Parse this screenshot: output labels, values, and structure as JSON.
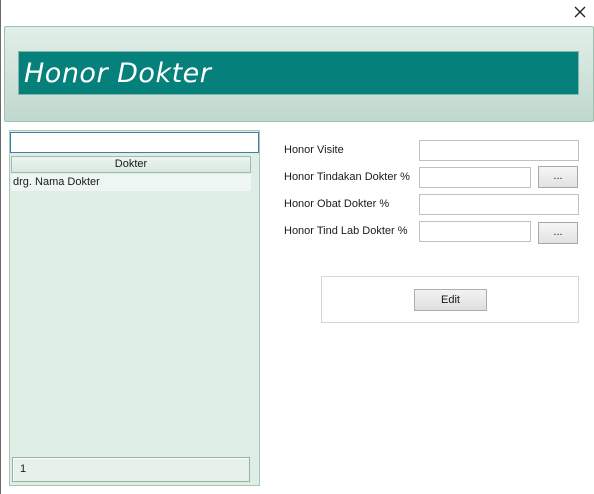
{
  "window": {
    "close_icon": "close-icon"
  },
  "header": {
    "title": "Honor Dokter"
  },
  "left_panel": {
    "search": {
      "value": "",
      "placeholder": ""
    },
    "grid": {
      "columns": [
        "Dokter"
      ],
      "rows": [
        [
          "drg. Nama Dokter"
        ]
      ]
    },
    "footer_count": "1"
  },
  "form": {
    "fields": [
      {
        "label": "Honor Visite",
        "value": ""
      },
      {
        "label": "Honor Tindakan Dokter %",
        "value": "",
        "button": "..."
      },
      {
        "label": "Honor Obat Dokter %",
        "value": ""
      },
      {
        "label": "Honor Tind Lab Dokter %",
        "value": "",
        "button": "..."
      }
    ],
    "edit_label": "Edit"
  },
  "colors": {
    "title_bar": "#06807a",
    "panel_bg": "#deeee4",
    "header_band": "#cfe2d9"
  }
}
